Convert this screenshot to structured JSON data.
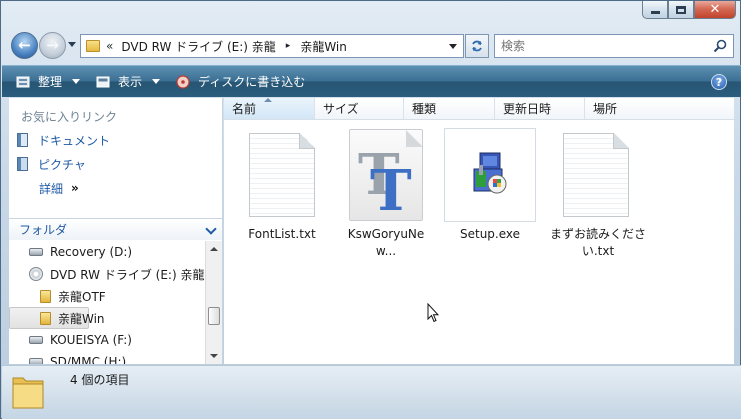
{
  "window": {
    "controls": {
      "minimize": "minimize",
      "maximize": "maximize",
      "close": "✕"
    }
  },
  "address_bar": {
    "overflow": "«",
    "segments": [
      "DVD RW ドライブ (E:) 亲龍",
      "亲龍Win"
    ],
    "separator": "▸"
  },
  "search": {
    "placeholder": "検索"
  },
  "toolbar": {
    "organize_label": "整理",
    "views_label": "表示",
    "burn_label": "ディスクに書き込む",
    "help_label": "?"
  },
  "nav_pane": {
    "favorites_header": "お気に入りリンク",
    "favorites": [
      {
        "label": "ドキュメント",
        "icon": "documents-icon"
      },
      {
        "label": "ピクチャ",
        "icon": "pictures-icon"
      }
    ],
    "more_label": "詳細",
    "more_chevron": "»",
    "folders_header": "フォルダ",
    "tree": [
      {
        "label": "Recovery (D:)",
        "icon": "drive-icon",
        "indent": 1
      },
      {
        "label": "DVD RW ドライブ (E:) 亲龍",
        "icon": "dvd-icon",
        "indent": 1
      },
      {
        "label": "亲龍OTF",
        "icon": "folder-icon",
        "indent": 2
      },
      {
        "label": "亲龍Win",
        "icon": "folder-icon",
        "indent": 2,
        "selected": true
      },
      {
        "label": "KOUEISYA (F:)",
        "icon": "drive-icon",
        "indent": 1
      },
      {
        "label": "SD/MMC (H:)",
        "icon": "drive-icon",
        "indent": 1
      }
    ]
  },
  "columns": [
    {
      "label": "名前",
      "sorted": true
    },
    {
      "label": "サイズ"
    },
    {
      "label": "種類"
    },
    {
      "label": "更新日時"
    },
    {
      "label": "場所"
    }
  ],
  "files": [
    {
      "name": "FontList.txt",
      "icon": "text-file-icon"
    },
    {
      "name": "KswGoryuNew...",
      "icon": "font-file-icon"
    },
    {
      "name": "Setup.exe",
      "icon": "installer-icon"
    },
    {
      "name": "まずお読みください.txt",
      "icon": "text-file-icon"
    }
  ],
  "status": {
    "item_count_text": "4 個の項目"
  },
  "colors": {
    "toolbar": "#3b6f93",
    "link": "#1f5aa5",
    "close_button": "#c0432b"
  }
}
